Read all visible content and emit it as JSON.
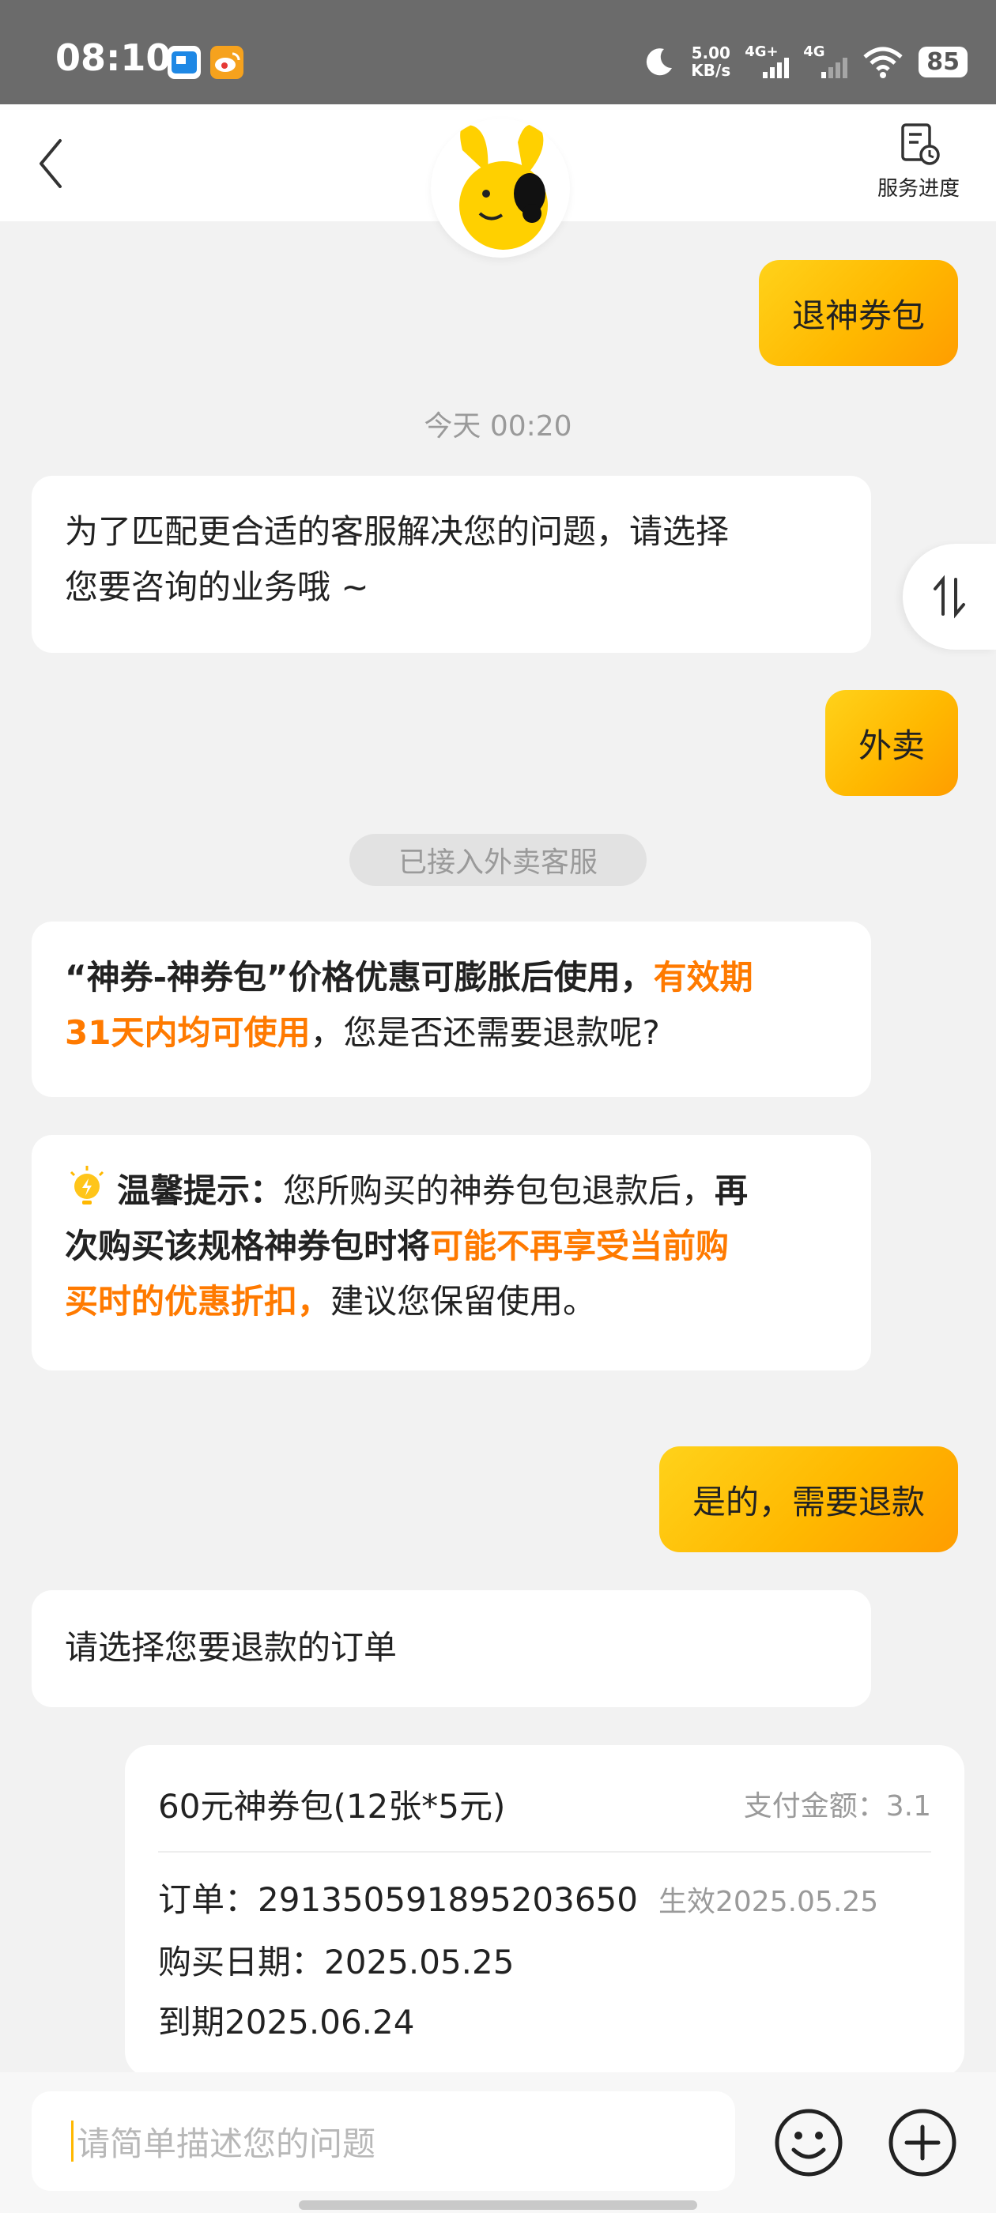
{
  "status_bar": {
    "time": "08:10",
    "net_speed_value": "5.00",
    "net_speed_unit": "KB/s",
    "signal1_label": "4G+",
    "signal2_label": "4G",
    "battery": "85",
    "icons": [
      "news-app-icon",
      "weibo-icon",
      "moon-icon",
      "wifi-icon"
    ]
  },
  "header": {
    "progress_label": "服务进度",
    "icons": [
      "back-icon",
      "service-progress-icon",
      "assistant-avatar"
    ]
  },
  "chat": {
    "msg1_user": "退神券包",
    "timestamp": "今天 00:20",
    "msg2_bot_line1": "为了匹配更合适的客服解决您的问题，请选择",
    "msg2_bot_line2": "您要咨询的业务哦 ~",
    "msg3_user": "外卖",
    "system_notice": "已接入外卖客服",
    "msg4_bold": "“神券-神券包”价格优惠可膨胀后使用，",
    "msg4_orange1": "有效期",
    "msg4_orange2": "31天内均可使用",
    "msg4_rest": "，您是否还需要退款呢?",
    "tip_title": "温馨提示：",
    "tip_text1": "您所购买的神券包包退款后，",
    "tip_bold1": "再",
    "tip_bold2": "次购买该规格神券包时将",
    "tip_orange1": "可能不再享受当前购",
    "tip_orange2": "买时的优惠折扣，",
    "tip_rest": "建议您保留使用。",
    "msg5_user": "是的，需要退款",
    "msg6_bot": "请选择您要退款的订单"
  },
  "order": {
    "name": "60元神券包(12张*5元)",
    "pay_amount": "支付金额：3.1",
    "order_no": "订单：291350591895203650",
    "effective": "生效2025.05.25",
    "purchase_date": "购买日期：2025.05.25",
    "expire": "到期2025.06.24"
  },
  "input": {
    "placeholder": "请简单描述您的问题"
  },
  "colors": {
    "accent_start": "#ffd21a",
    "accent_end": "#ff9d00",
    "highlight": "#ff7a00"
  }
}
